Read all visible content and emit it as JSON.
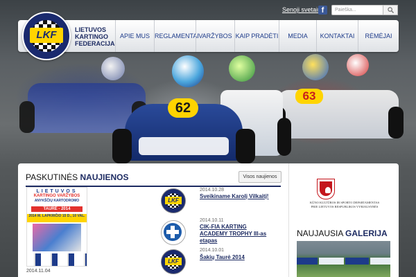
{
  "topbar": {
    "old_site_link": "Senoji svetainė",
    "facebook_icon": "facebook-icon",
    "search_placeholder": "Paieška...",
    "search_icon": "magnifier-icon"
  },
  "logo": {
    "text": "LKF",
    "org_line1": "LIETUVOS",
    "org_line2": "KARTINGO",
    "org_line3": "FEDERACIJA"
  },
  "nav": {
    "items": [
      "APIE MUS",
      "REGLAMENTAI",
      "VARŽYBOS",
      "KAIP PRADĖTI",
      "MEDIA",
      "KONTAKTAI",
      "RĖMĖJAI"
    ]
  },
  "hero": {
    "kart_numbers": [
      "62",
      "63"
    ]
  },
  "news": {
    "heading_light": "PASKUTINĖS",
    "heading_bold": "NAUJIENOS",
    "all_news_button": "Visos naujienos",
    "poster": {
      "line1": "LIETUVOS",
      "line2": "KARTINGO VARŽYBOS",
      "line3": "ANYKŠČIŲ KARTODROMO",
      "band": "TAURĖ - 2014",
      "date_line": "2014 M. LAPKRIČIO 15 D., 10 VAL."
    },
    "featured_date": "2014.11.04",
    "items": [
      {
        "date": "2014.10.28",
        "title": "Sveikiname Karolį Vilkaitį!"
      },
      {
        "date": "2014.10.11",
        "title": "CIK-FIA KARTING ACADEMY TROPHY III-as etapas"
      },
      {
        "date": "2014.10.01",
        "title": "Šakių Taurė 2014"
      }
    ]
  },
  "sidebar": {
    "department_line1": "KŪNO KULTŪROS IR SPORTO DEPARTAMENTAS",
    "department_line2": "PRIE LIETUVOS RESPUBLIKOS VYRIAUSYBĖS",
    "gallery_heading_light": "NAUJAUSIA",
    "gallery_heading_bold": "GALERIJA"
  },
  "colors": {
    "brand_navy": "#1d2b62",
    "brand_yellow": "#ffd400",
    "accent_red": "#e3312d"
  }
}
